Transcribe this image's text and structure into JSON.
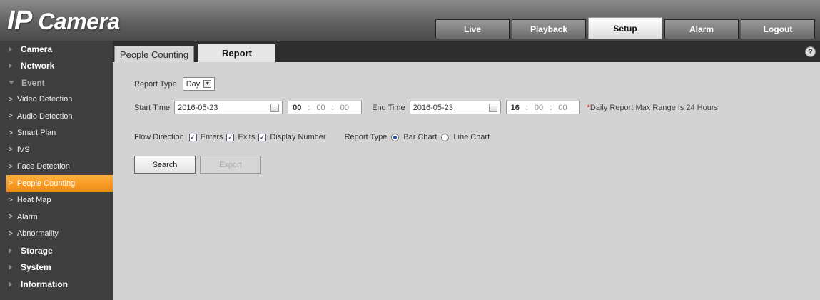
{
  "app": {
    "logo_prefix": "IP",
    "logo_suffix": "Camera"
  },
  "topnav": [
    {
      "label": "Live"
    },
    {
      "label": "Playback"
    },
    {
      "label": "Setup"
    },
    {
      "label": "Alarm"
    },
    {
      "label": "Logout"
    }
  ],
  "sidebar": {
    "camera": "Camera",
    "network": "Network",
    "event": "Event",
    "sub": [
      {
        "label": "Video Detection"
      },
      {
        "label": "Audio Detection"
      },
      {
        "label": "Smart Plan"
      },
      {
        "label": "IVS"
      },
      {
        "label": "Face Detection"
      },
      {
        "label": "People Counting"
      },
      {
        "label": "Heat Map"
      },
      {
        "label": "Alarm"
      },
      {
        "label": "Abnormality"
      }
    ],
    "storage": "Storage",
    "system": "System",
    "information": "Information"
  },
  "tabs": {
    "people_counting": "People Counting",
    "report": "Report"
  },
  "help": "?",
  "form": {
    "report_type_label": "Report Type",
    "report_type_value": "Day",
    "start_time_label": "Start Time",
    "start_date": "2016-05-23",
    "start_hour": "00",
    "start_min": "00",
    "start_sec": "00",
    "end_time_label": "End Time",
    "end_date": "2016-05-23",
    "end_hour": "16",
    "end_min": "00",
    "end_sec": "00",
    "note_star": "*",
    "note": "Daily Report Max Range Is 24 Hours",
    "flow_direction_label": "Flow Direction",
    "enters": "Enters",
    "exits": "Exits",
    "display_number": "Display Number",
    "chart_type_label": "Report Type",
    "bar_chart": "Bar Chart",
    "line_chart": "Line Chart",
    "sep": ":"
  },
  "buttons": {
    "search": "Search",
    "export": "Export"
  }
}
